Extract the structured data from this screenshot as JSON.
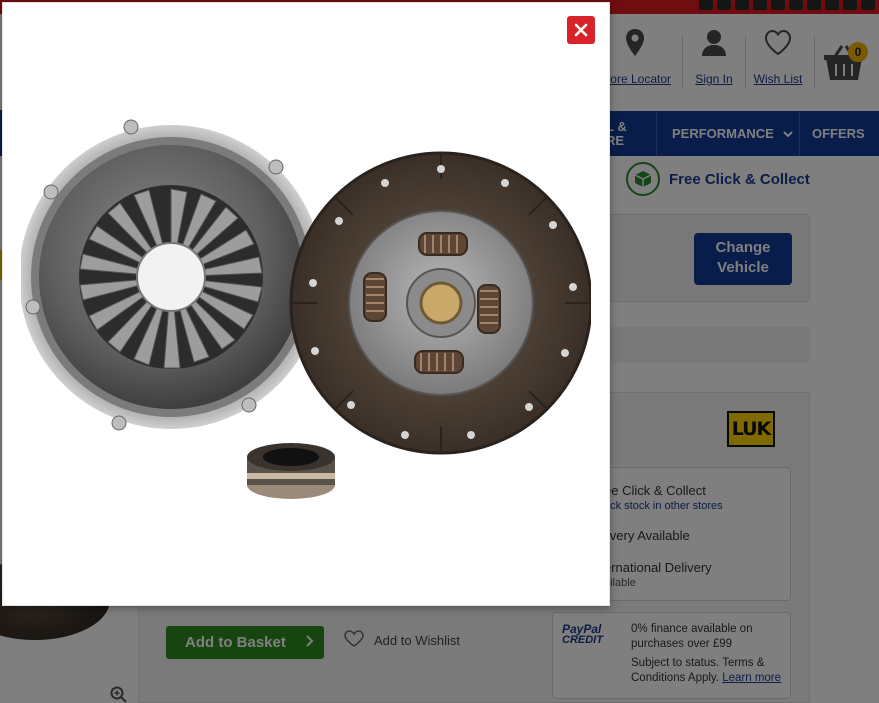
{
  "header": {
    "store_locator_label": "Store Locator",
    "sign_in_label": "Sign In",
    "wish_list_label": "Wish List",
    "basket_count": "0"
  },
  "nav": {
    "item_partial": "L &\nRE",
    "performance_label": "PERFORMANCE",
    "offers_label": "OFFERS"
  },
  "click_collect_label": "Free Click & Collect",
  "vehicle": {
    "change_button_label": "Change\nVehicle"
  },
  "brand_logo_text": "LUK",
  "delivery": {
    "click_collect": "ee Click & Collect",
    "check_stock": "eck stock in other stores",
    "delivery_available": "livery Available",
    "international": "ernational Delivery",
    "international_sub": "ailable"
  },
  "paypal": {
    "logo_line1": "PayPal",
    "logo_line2": "CREDIT",
    "finance_text": "0% finance available on purchases over £99",
    "terms_text": "Subject to status. Terms & Conditions Apply.",
    "learn_more": "Learn more"
  },
  "actions": {
    "add_to_basket": "Add to Basket",
    "add_to_wishlist": "Add to Wishlist"
  },
  "modal": {
    "close_symbol": "✕",
    "image_subject": "clutch kit"
  },
  "colors": {
    "topbar_red": "#e11b22",
    "nav_blue": "#123a96",
    "basket_badge": "#f4b400",
    "add_button_green": "#2f8a1f",
    "close_red": "#d8232a",
    "luk_yellow": "#ffd200"
  }
}
